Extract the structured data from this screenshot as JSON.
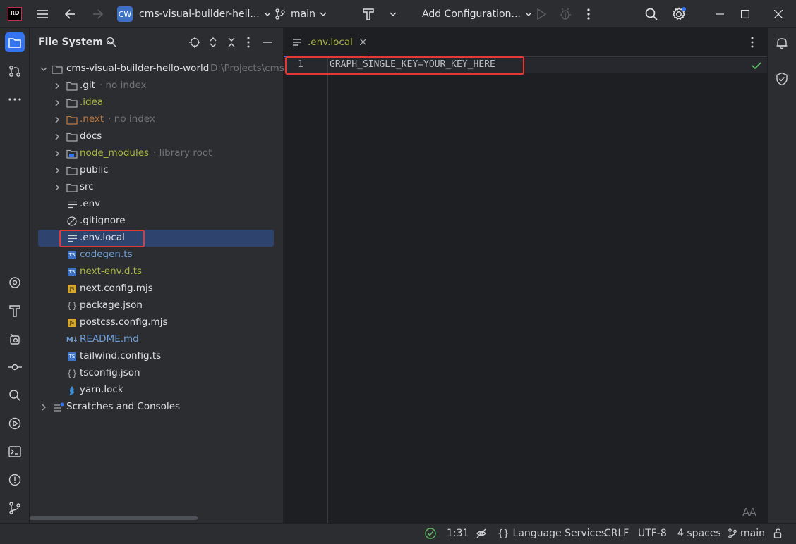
{
  "titlebar": {
    "app_logo": "RD",
    "project_badge": "CW",
    "project_name": "cms-visual-builder-hell...",
    "branch": "main",
    "run_config": "Add Configuration..."
  },
  "project_panel": {
    "title": "File System",
    "root": {
      "name": "cms-visual-builder-hello-world",
      "path": "D:\\Projects\\cms-"
    },
    "items": [
      {
        "name": ".git",
        "hint": "no index",
        "kind": "folder",
        "color": "#dfe1e5"
      },
      {
        "name": ".idea",
        "hint": "",
        "kind": "folder",
        "color": "#a9b542"
      },
      {
        "name": ".next",
        "hint": "no index",
        "kind": "folder-orange",
        "color": "#c57a3d"
      },
      {
        "name": "docs",
        "hint": "",
        "kind": "folder",
        "color": "#dfe1e5"
      },
      {
        "name": "node_modules",
        "hint": "library root",
        "kind": "folder-lib",
        "color": "#a9b542"
      },
      {
        "name": "public",
        "hint": "",
        "kind": "folder",
        "color": "#dfe1e5"
      },
      {
        "name": "src",
        "hint": "",
        "kind": "folder",
        "color": "#dfe1e5"
      },
      {
        "name": ".env",
        "hint": "",
        "kind": "text",
        "color": "#dfe1e5"
      },
      {
        "name": ".gitignore",
        "hint": "",
        "kind": "ignore",
        "color": "#dfe1e5"
      },
      {
        "name": ".env.local",
        "hint": "",
        "kind": "text",
        "color": "#dfe1e5"
      },
      {
        "name": "codegen.ts",
        "hint": "",
        "kind": "ts",
        "color": "#6f9fdb"
      },
      {
        "name": "next-env.d.ts",
        "hint": "",
        "kind": "ts",
        "color": "#a9b542"
      },
      {
        "name": "next.config.mjs",
        "hint": "",
        "kind": "js",
        "color": "#dfe1e5"
      },
      {
        "name": "package.json",
        "hint": "",
        "kind": "json",
        "color": "#dfe1e5"
      },
      {
        "name": "postcss.config.mjs",
        "hint": "",
        "kind": "js",
        "color": "#dfe1e5"
      },
      {
        "name": "README.md",
        "hint": "",
        "kind": "md",
        "color": "#6f9fdb"
      },
      {
        "name": "tailwind.config.ts",
        "hint": "",
        "kind": "ts",
        "color": "#dfe1e5"
      },
      {
        "name": "tsconfig.json",
        "hint": "",
        "kind": "json",
        "color": "#dfe1e5"
      },
      {
        "name": "yarn.lock",
        "hint": "",
        "kind": "yarn",
        "color": "#dfe1e5"
      }
    ],
    "scratches": "Scratches and Consoles",
    "icon_labels": {
      "ts": "TS",
      "js": "JS",
      "md": "M↓",
      "json": "{}",
      "lib": "lib"
    }
  },
  "editor": {
    "tab_label": ".env.local",
    "line_number": "1",
    "code_line": "GRAPH_SINGLE_KEY=YOUR_KEY_HERE",
    "reader_icon_label": "AA"
  },
  "statusbar": {
    "position": "1:31",
    "language_services": "Language Services",
    "line_separator": "CRLF",
    "encoding": "UTF-8",
    "indent": "4 spaces",
    "branch": "main"
  },
  "colors": {
    "accent": "#3574f0",
    "selection": "#2e436e",
    "highlight": "#e53935",
    "ok": "#5fb865"
  }
}
